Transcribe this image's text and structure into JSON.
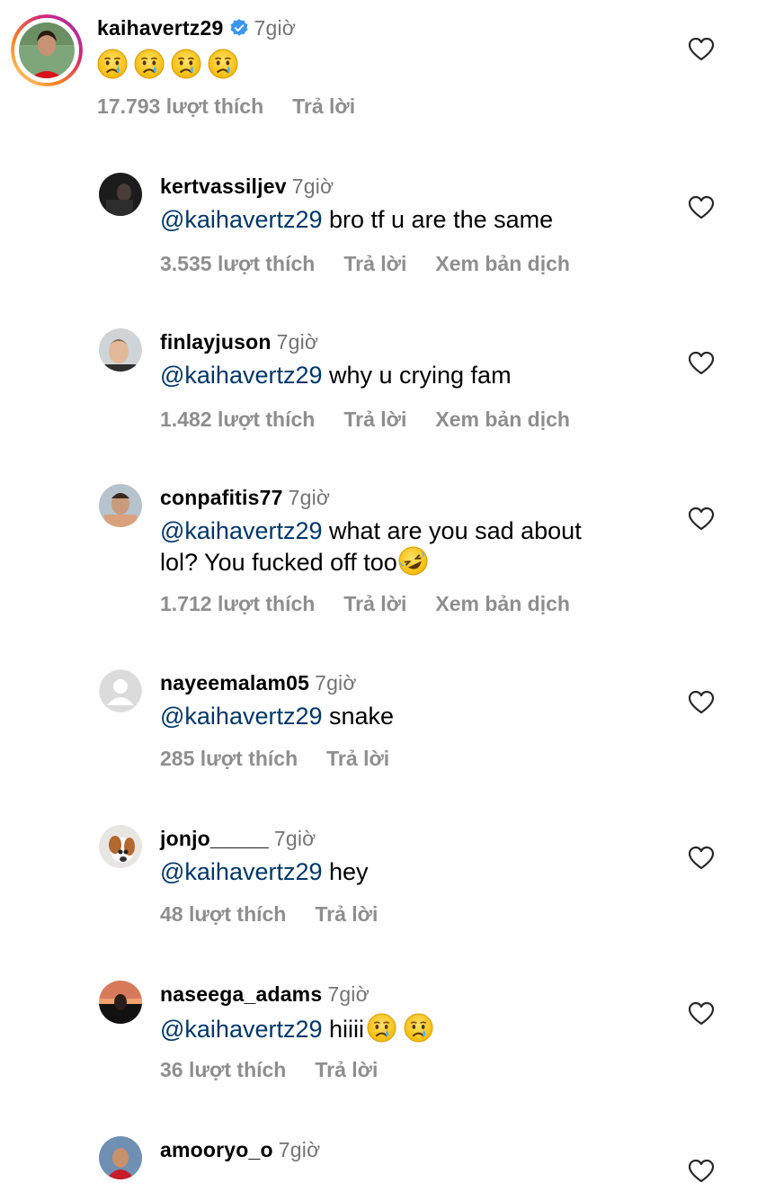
{
  "top_comment": {
    "username": "kaihavertz29",
    "time": "7giờ",
    "likes": "17.793 lượt thích",
    "reply": "Trả lời",
    "emoji_count": 4,
    "emoji": "crying-face"
  },
  "replies": [
    {
      "username": "kertvassiljev",
      "time": "7giờ",
      "mention": "@kaihavertz29",
      "text": " bro tf u are the same",
      "likes": "3.535 lượt thích",
      "reply": "Trả lời",
      "translate": "Xem bản dịch"
    },
    {
      "username": "finlayjuson",
      "time": "7giờ",
      "mention": "@kaihavertz29",
      "text": " why u crying fam",
      "likes": "1.482 lượt thích",
      "reply": "Trả lời",
      "translate": "Xem bản dịch"
    },
    {
      "username": "conpafitis77",
      "time": "7giờ",
      "mention": "@kaihavertz29",
      "text": " what are you sad about",
      "text_line2": "lol? You fucked off too",
      "trailing_emoji": "rolling-on-floor-laughing",
      "likes": "1.712 lượt thích",
      "reply": "Trả lời",
      "translate": "Xem bản dịch"
    },
    {
      "username": "nayeemalam05",
      "time": "7giờ",
      "mention": "@kaihavertz29",
      "text": " snake",
      "likes": "285 lượt thích",
      "reply": "Trả lời"
    },
    {
      "username": "jonjo_____",
      "time": "7giờ",
      "mention": "@kaihavertz29",
      "text": " hey",
      "likes": "48 lượt thích",
      "reply": "Trả lời"
    },
    {
      "username": "naseega_adams",
      "time": "7giờ",
      "mention": "@kaihavertz29",
      "text": " hiiii",
      "trailing_emoji": "crying-face x2",
      "likes": "36 lượt thích",
      "reply": "Trả lời"
    },
    {
      "username": "amooryo_o",
      "time": "7giờ"
    }
  ],
  "colors": {
    "mention": "#00376b",
    "meta": "#8e8e8e",
    "verified": "#3897f0",
    "story_ring": [
      "#feda75",
      "#fa7e1e",
      "#d62976",
      "#962fbf"
    ]
  }
}
